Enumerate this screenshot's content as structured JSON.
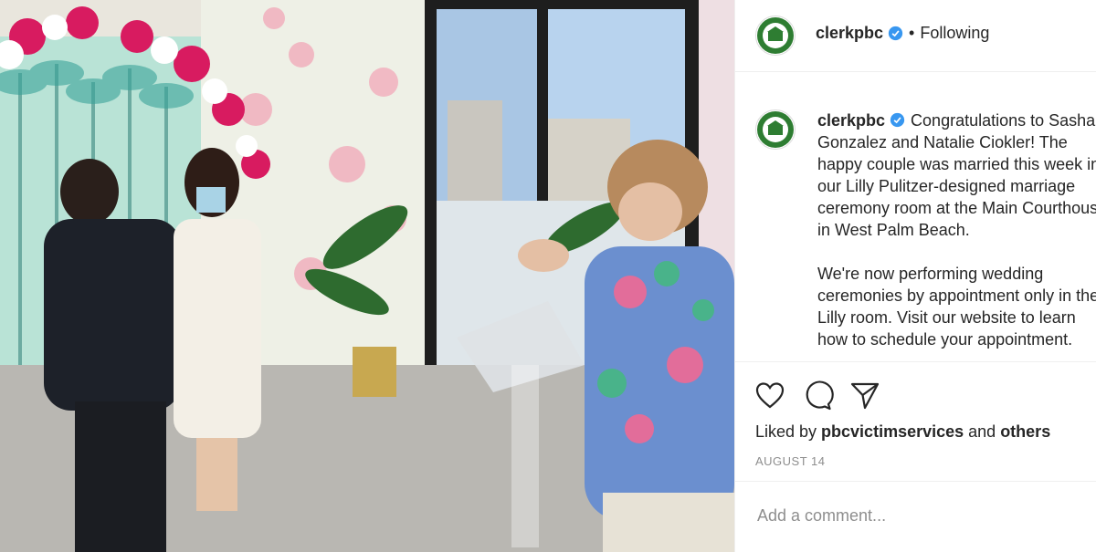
{
  "post": {
    "image_alt": "Wedding ceremony in a floral decorated courthouse room",
    "photo_icon": "wedding-photo-image"
  },
  "header": {
    "username": "clerkpbc",
    "separator": "•",
    "follow_status": "Following",
    "verified_icon": "verified-badge-icon"
  },
  "caption": {
    "username": "clerkpbc",
    "paragraph1": "Congratulations to Sasha Gonzalez and Natalie Ciokler! The happy couple was married this week in our Lilly Pulitzer-designed marriage ceremony room at the Main Courthouse in West Palm Beach.",
    "paragraph2": "We're now performing wedding ceremonies by appointment only in the Lilly room. Visit our website to learn how to schedule your appointment."
  },
  "actions": {
    "icons": [
      "heart-icon",
      "comment-icon",
      "share-icon"
    ],
    "liked_by_prefix": "Liked by ",
    "liked_by_user": "pbcvictimservices",
    "liked_by_and": " and ",
    "liked_by_others": "others",
    "date": "AUGUST 14"
  },
  "comment": {
    "placeholder": "Add a comment..."
  },
  "colors": {
    "verified": "#3897f0",
    "avatar_green": "#2e7d32",
    "border": "#efefef",
    "muted": "#8e8e8e"
  }
}
